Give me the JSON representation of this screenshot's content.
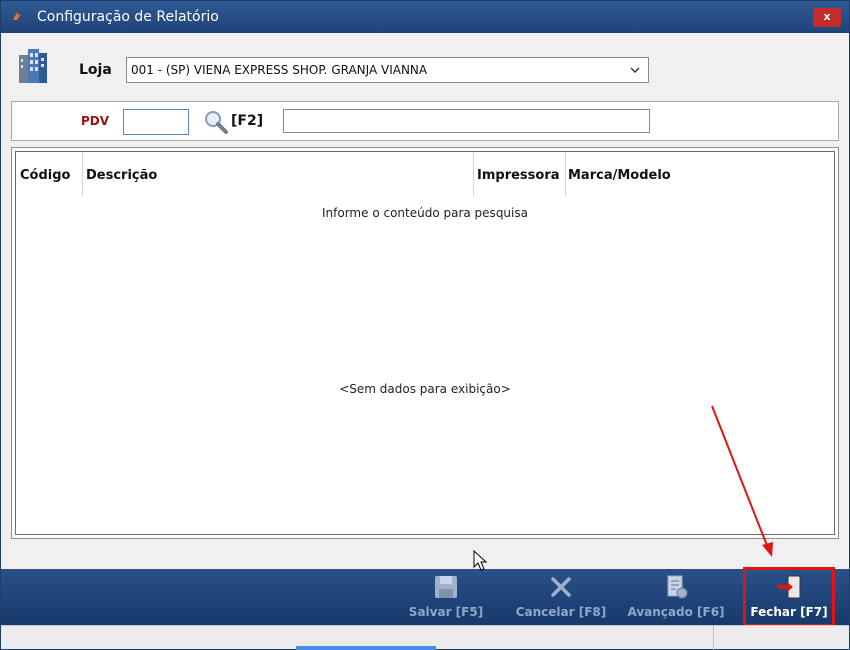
{
  "window": {
    "title": "Configuração de Relatório",
    "close_label": "x"
  },
  "loja": {
    "label": "Loja",
    "selected_value": "001 - (SP) VIENA EXPRESS  SHOP. GRANJA VIANNA",
    "icon": "store-building-icon"
  },
  "pdv": {
    "label": "PDV",
    "code_value": "",
    "search_shortcut": "[F2]",
    "description_value": ""
  },
  "grid": {
    "columns": [
      "Código",
      "Descrição",
      "Impressora",
      "Marca/Modelo"
    ],
    "info_text": "Informe o conteúdo para pesquisa",
    "empty_text": "<Sem dados para exibição>"
  },
  "toolbar": {
    "buttons": [
      {
        "label": "Salvar [F5]",
        "icon": "floppy-disk-icon",
        "enabled": false
      },
      {
        "label": "Cancelar [F8]",
        "icon": "x-cancel-icon",
        "enabled": false
      },
      {
        "label": "Avançado [F6]",
        "icon": "advanced-settings-icon",
        "enabled": false
      },
      {
        "label": "Fechar [F7]",
        "icon": "exit-door-icon",
        "enabled": true
      }
    ]
  },
  "colors": {
    "toolbar_bg": "#1f4379",
    "pdv_label": "#9a1010",
    "highlight": "#e01414"
  }
}
